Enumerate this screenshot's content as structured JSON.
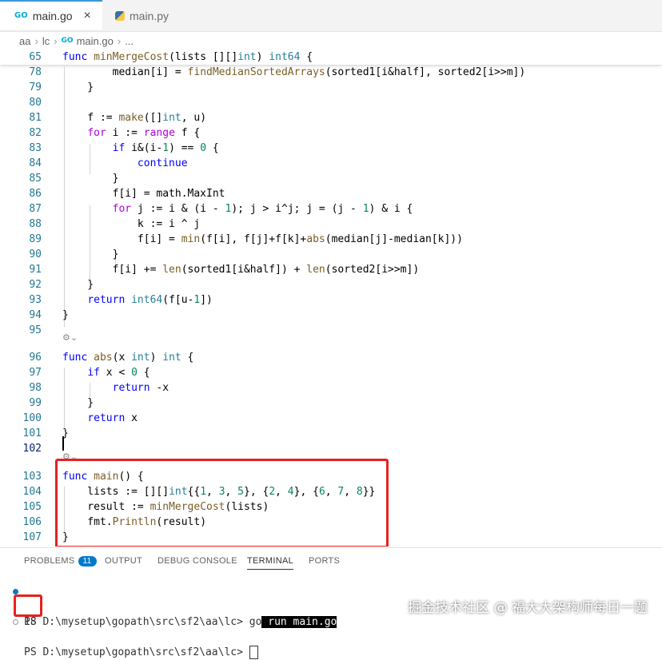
{
  "tabs": [
    {
      "label": "main.go",
      "icon": "go-gopher-icon",
      "active": true
    },
    {
      "label": "main.py",
      "icon": "python-icon",
      "active": false
    }
  ],
  "tab_close": "×",
  "breadcrumb": [
    "aa",
    "lc",
    "main.go",
    "..."
  ],
  "go_icon_text": "GO",
  "code_lens_glyph": "⚙⌄",
  "code": {
    "lines": [
      {
        "n": "65",
        "text": "func minMergeCost(lists [][]int) int64 {"
      },
      {
        "n": "78",
        "text": "        median[i] = findMedianSortedArrays(sorted1[i&half], sorted2[i>>m])"
      },
      {
        "n": "79",
        "text": "    }"
      },
      {
        "n": "80",
        "text": ""
      },
      {
        "n": "81",
        "text": "    f := make([]int, u)"
      },
      {
        "n": "82",
        "text": "    for i := range f {"
      },
      {
        "n": "83",
        "text": "        if i&(i-1) == 0 {"
      },
      {
        "n": "84",
        "text": "            continue"
      },
      {
        "n": "85",
        "text": "        }"
      },
      {
        "n": "86",
        "text": "        f[i] = math.MaxInt"
      },
      {
        "n": "87",
        "text": "        for j := i & (i - 1); j > i^j; j = (j - 1) & i {"
      },
      {
        "n": "88",
        "text": "            k := i ^ j"
      },
      {
        "n": "89",
        "text": "            f[i] = min(f[i], f[j]+f[k]+abs(median[j]-median[k]))"
      },
      {
        "n": "90",
        "text": "        }"
      },
      {
        "n": "91",
        "text": "        f[i] += len(sorted1[i&half]) + len(sorted2[i>>m])"
      },
      {
        "n": "92",
        "text": "    }"
      },
      {
        "n": "93",
        "text": "    return int64(f[u-1])"
      },
      {
        "n": "94",
        "text": "}"
      },
      {
        "n": "95",
        "text": ""
      },
      {
        "n": "96",
        "text": "func abs(x int) int {"
      },
      {
        "n": "97",
        "text": "    if x < 0 {"
      },
      {
        "n": "98",
        "text": "        return -x"
      },
      {
        "n": "99",
        "text": "    }"
      },
      {
        "n": "100",
        "text": "    return x"
      },
      {
        "n": "101",
        "text": "}"
      },
      {
        "n": "102",
        "text": ""
      },
      {
        "n": "103",
        "text": "func main() {"
      },
      {
        "n": "104",
        "text": "    lists := [][]int{{1, 3, 5}, {2, 4}, {6, 7, 8}}"
      },
      {
        "n": "105",
        "text": "    result := minMergeCost(lists)"
      },
      {
        "n": "106",
        "text": "    fmt.Println(result)"
      },
      {
        "n": "107",
        "text": "}"
      }
    ]
  },
  "panel": {
    "tabs": [
      "PROBLEMS",
      "OUTPUT",
      "DEBUG CONSOLE",
      "TERMINAL",
      "PORTS"
    ],
    "problems_count": "11",
    "active_tab": "TERMINAL"
  },
  "terminal": {
    "prompt1": "PS D:\\mysetup\\gopath\\src\\sf2\\aa\\lc> ",
    "cmd_go": "go",
    "cmd_rest": " run main.go",
    "output": "18",
    "prompt2": "PS D:\\mysetup\\gopath\\src\\sf2\\aa\\lc> "
  },
  "watermark": "掘金技术社区 @ 福大大架构师每日一题",
  "colors": {
    "accent": "#007acc",
    "highlight_box": "#e5221f",
    "keyword": "#0000ff",
    "control": "#af00db",
    "function": "#795e26",
    "type": "#267f99",
    "number": "#098658"
  }
}
